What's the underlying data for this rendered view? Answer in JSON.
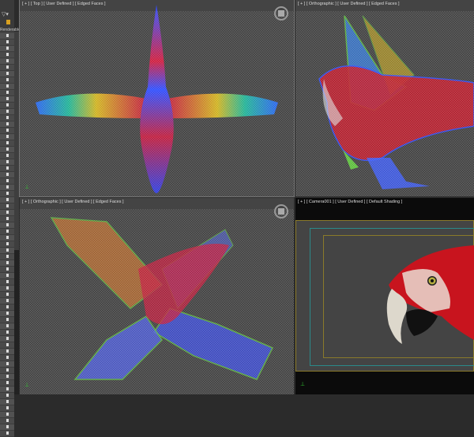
{
  "command_panel": {
    "column_label": "Renderable",
    "row_count": 64
  },
  "viewports": [
    {
      "id": "top",
      "label": "[ + ] [ Top ] [ User Defined ] [ Edged Faces ]"
    },
    {
      "id": "ortho1",
      "label": "[ + ] [ Orthographic ] [ User Defined ] [ Edged Faces ]"
    },
    {
      "id": "ortho2",
      "label": "[ + ] [ Orthographic ] [ User Defined ] [ Edged Faces ]"
    },
    {
      "id": "camera",
      "label": "[ + ] [ Camera001 ] [ User Defined ] [ Default Shading ]"
    }
  ],
  "colors": {
    "viewport_bg": "#444444",
    "camera_bg": "#0b0b0b",
    "safe_frame_outer": "#8a7a2a",
    "safe_frame_mid": "#2a8a8a",
    "parrot_red": "#c8141e"
  }
}
